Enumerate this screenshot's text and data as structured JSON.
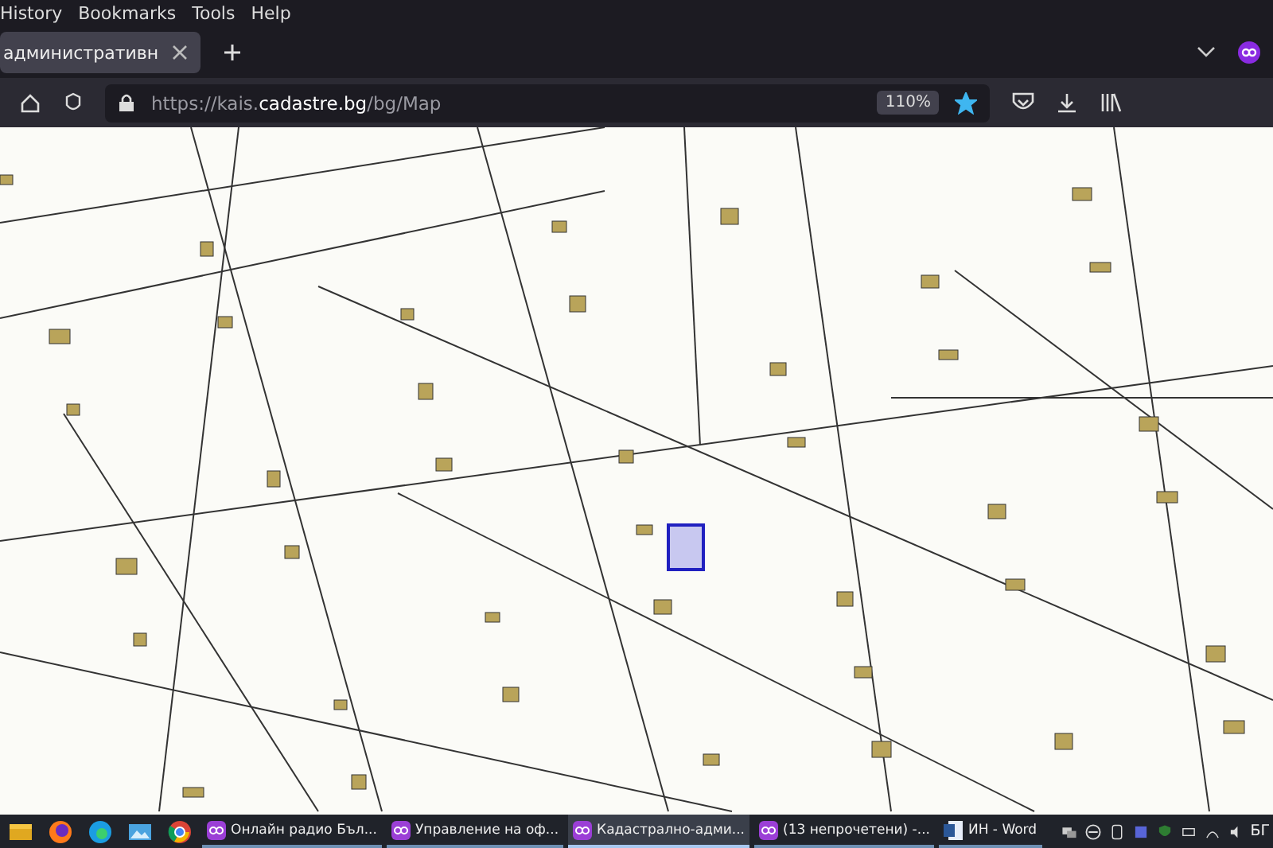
{
  "menu_bar": {
    "items": [
      "History",
      "Bookmarks",
      "Tools",
      "Help"
    ]
  },
  "tabs": [
    {
      "label": "административн",
      "selected": true
    }
  ],
  "address_bar": {
    "url_host_prefix": "https://kais.",
    "url_host": "cadastre.bg",
    "url_path": "/bg/Map",
    "zoom": "110%",
    "bookmarked": true
  },
  "taskbar": {
    "pinned": [
      {
        "kind": "folder"
      },
      {
        "kind": "firefox"
      },
      {
        "kind": "edge"
      },
      {
        "kind": "photos"
      },
      {
        "kind": "chrome"
      }
    ],
    "tasks": [
      {
        "kind": "browser",
        "label": "Онлайн радио Бъл...",
        "selected": false
      },
      {
        "kind": "browser",
        "label": "Управление на оф...",
        "selected": false
      },
      {
        "kind": "browser",
        "label": "Кадастрално-адми...",
        "selected": true
      },
      {
        "kind": "browser",
        "label": "(13 непрочетени) -...",
        "selected": false
      },
      {
        "kind": "word",
        "label": "ИН - Word",
        "selected": false
      }
    ],
    "language": "БГ"
  }
}
